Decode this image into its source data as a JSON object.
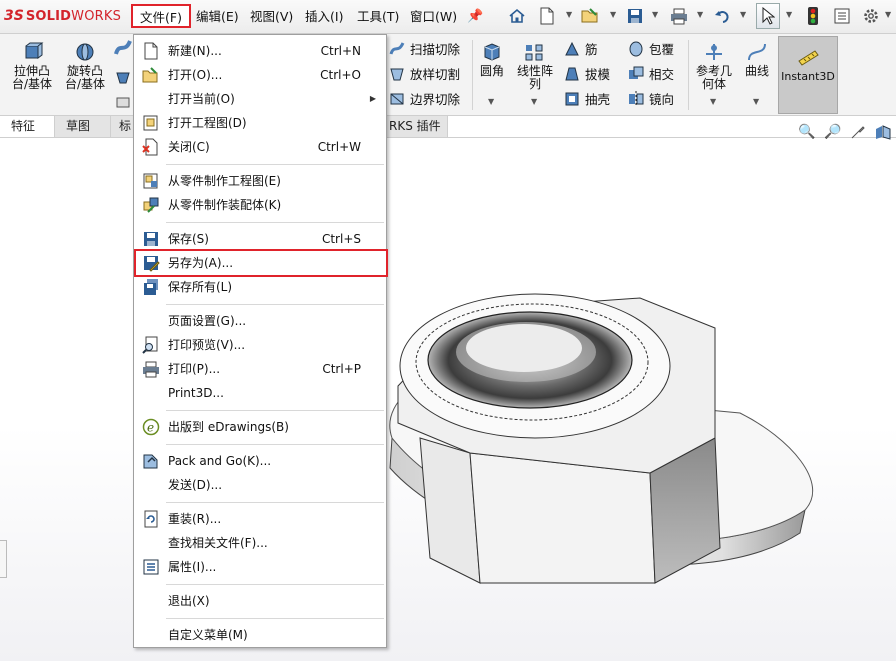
{
  "app": {
    "brand_ds": "3S",
    "brand_solid": "SOLID",
    "brand_works": "WORKS"
  },
  "menubar": {
    "items": [
      {
        "label": "文件(F)",
        "active": true
      },
      {
        "label": "编辑(E)"
      },
      {
        "label": "视图(V)"
      },
      {
        "label": "插入(I)"
      },
      {
        "label": "工具(T)"
      },
      {
        "label": "窗口(W)"
      }
    ]
  },
  "ribbon": {
    "big": [
      {
        "label1": "拉伸凸",
        "label2": "台/基体"
      },
      {
        "label1": "旋转凸",
        "label2": "台/基体"
      },
      {
        "label1": "圆角",
        "label2": ""
      },
      {
        "label1": "线性阵",
        "label2": "列"
      },
      {
        "label1": "参考几",
        "label2": "何体"
      },
      {
        "label1": "曲线",
        "label2": ""
      }
    ],
    "small": [
      {
        "label": "扫描切除"
      },
      {
        "label": "放样切割"
      },
      {
        "label": "边界切除"
      },
      {
        "label": "筋"
      },
      {
        "label": "拔模"
      },
      {
        "label": "抽壳"
      },
      {
        "label": "包覆"
      },
      {
        "label": "相交"
      },
      {
        "label": "镜向"
      }
    ],
    "instant3d": "Instant3D"
  },
  "tabs": [
    {
      "label": "特征"
    },
    {
      "label": "草图"
    },
    {
      "label": "标"
    },
    {
      "label": "RKS 插件"
    }
  ],
  "file_menu": {
    "items": [
      {
        "label": "新建(N)...",
        "shortcut": "Ctrl+N",
        "icon": "new-document-icon"
      },
      {
        "label": "打开(O)...",
        "shortcut": "Ctrl+O",
        "icon": "open-folder-icon"
      },
      {
        "label": "打开当前(O)",
        "shortcut": "",
        "icon": "",
        "submenu": true
      },
      {
        "label": "打开工程图(D)",
        "shortcut": "",
        "icon": "open-drawing-icon"
      },
      {
        "label": "关闭(C)",
        "shortcut": "Ctrl+W",
        "icon": "close-document-icon"
      },
      {
        "label": "从零件制作工程图(E)",
        "shortcut": "",
        "icon": "make-drawing-icon"
      },
      {
        "label": "从零件制作装配体(K)",
        "shortcut": "",
        "icon": "make-assembly-icon"
      },
      {
        "label": "保存(S)",
        "shortcut": "Ctrl+S",
        "icon": "save-icon"
      },
      {
        "label": "另存为(A)...",
        "shortcut": "",
        "icon": "save-as-icon",
        "highlighted": true
      },
      {
        "label": "保存所有(L)",
        "shortcut": "",
        "icon": "save-all-icon"
      },
      {
        "label": "页面设置(G)...",
        "shortcut": "",
        "icon": ""
      },
      {
        "label": "打印预览(V)...",
        "shortcut": "",
        "icon": "print-preview-icon"
      },
      {
        "label": "打印(P)...",
        "shortcut": "Ctrl+P",
        "icon": "print-icon"
      },
      {
        "label": "Print3D...",
        "shortcut": "",
        "icon": ""
      },
      {
        "label": "出版到 eDrawings(B)",
        "shortcut": "",
        "icon": "edrawings-icon"
      },
      {
        "label": "Pack and Go(K)...",
        "shortcut": "",
        "icon": "pack-and-go-icon"
      },
      {
        "label": "发送(D)...",
        "shortcut": "",
        "icon": ""
      },
      {
        "label": "重装(R)...",
        "shortcut": "",
        "icon": "reload-icon"
      },
      {
        "label": "查找相关文件(F)...",
        "shortcut": "",
        "icon": ""
      },
      {
        "label": "属性(I)...",
        "shortcut": "",
        "icon": "properties-icon"
      },
      {
        "label": "退出(X)",
        "shortcut": "",
        "icon": ""
      },
      {
        "label": "自定义菜单(M)",
        "shortcut": "",
        "icon": ""
      }
    ]
  },
  "colors": {
    "highlight_border": "#e0232b",
    "brand_red": "#d3242b",
    "icon_blue": "#2b5c93"
  }
}
